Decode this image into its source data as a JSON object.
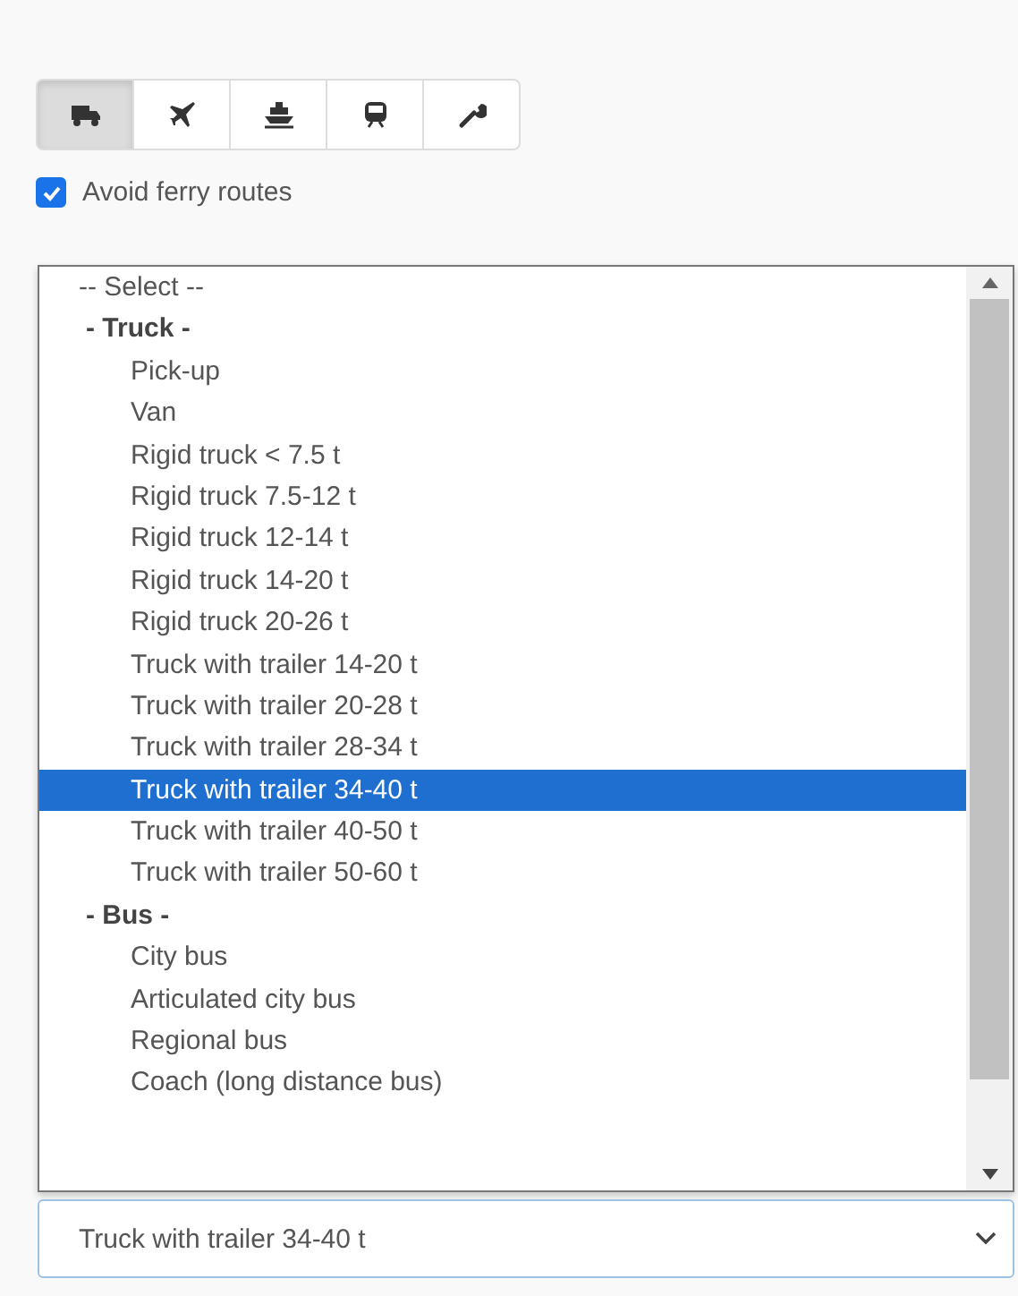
{
  "modes": [
    {
      "kind": "truck",
      "selected": true
    },
    {
      "kind": "plane",
      "selected": false
    },
    {
      "kind": "ship",
      "selected": false
    },
    {
      "kind": "train",
      "selected": false
    },
    {
      "kind": "wrench",
      "selected": false
    }
  ],
  "avoid_ferry": {
    "label": "Avoid ferry routes",
    "checked": true
  },
  "listbox": {
    "options": [
      {
        "kind": "placeholder",
        "label": "-- Select --",
        "selected": false
      },
      {
        "kind": "group",
        "label": "- Truck -",
        "children": [
          {
            "label": "Pick-up",
            "selected": false
          },
          {
            "label": "Van",
            "selected": false
          },
          {
            "label": "Rigid truck < 7.5 t",
            "selected": false
          },
          {
            "label": "Rigid truck 7.5-12 t",
            "selected": false
          },
          {
            "label": "Rigid truck 12-14 t",
            "selected": false
          },
          {
            "label": "Rigid truck 14-20 t",
            "selected": false
          },
          {
            "label": "Rigid truck 20-26 t",
            "selected": false
          },
          {
            "label": "Truck with trailer 14-20 t",
            "selected": false
          },
          {
            "label": "Truck with trailer 20-28 t",
            "selected": false
          },
          {
            "label": "Truck with trailer 28-34 t",
            "selected": false
          },
          {
            "label": "Truck with trailer 34-40 t",
            "selected": true
          },
          {
            "label": "Truck with trailer 40-50 t",
            "selected": false
          },
          {
            "label": "Truck with trailer 50-60 t",
            "selected": false
          }
        ]
      },
      {
        "kind": "group",
        "label": "- Bus -",
        "children": [
          {
            "label": "City bus",
            "selected": false
          },
          {
            "label": "Articulated city bus",
            "selected": false
          },
          {
            "label": "Regional bus",
            "selected": false
          },
          {
            "label": "Coach (long distance bus)",
            "selected": false
          }
        ]
      }
    ]
  },
  "select": {
    "value": "Truck with trailer 34-40 t"
  }
}
